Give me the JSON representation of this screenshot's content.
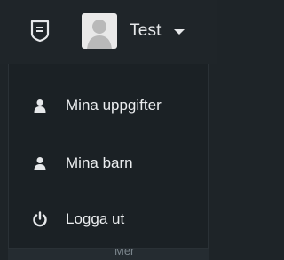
{
  "header": {
    "user_name": "Test",
    "icons": {
      "left": "document-list-icon",
      "avatar": "user-avatar",
      "toggle": "caret-down-icon"
    }
  },
  "menu": {
    "items": [
      {
        "label": "Mina uppgifter",
        "icon": "person-icon"
      },
      {
        "label": "Mina barn",
        "icon": "person-icon"
      },
      {
        "label": "Logga ut",
        "icon": "power-icon"
      }
    ]
  },
  "background": {
    "partial_text": "Mer"
  },
  "colors": {
    "header_bg": "#1f2529",
    "menu_bg": "#1b2125",
    "text": "#eceef0"
  }
}
